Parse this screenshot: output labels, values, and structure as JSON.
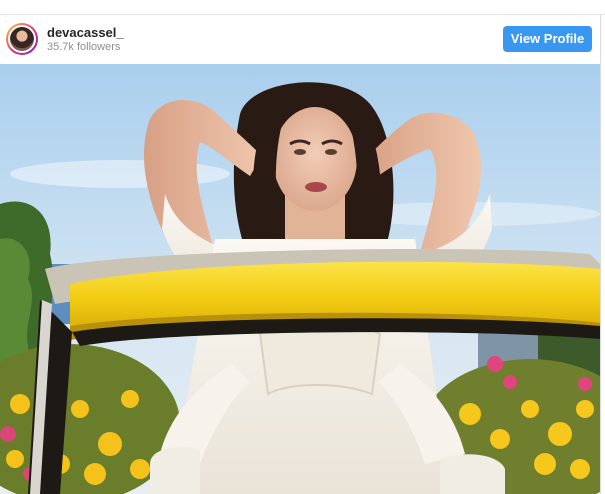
{
  "profile": {
    "username": "devacassel_",
    "followers": "35.7k followers",
    "view_profile_label": "View Profile"
  },
  "colors": {
    "button": "#3897f0",
    "car_yellow": "#f4d21a",
    "sky": "#c6def0"
  },
  "icons": {
    "avatar": "profile-photo"
  }
}
